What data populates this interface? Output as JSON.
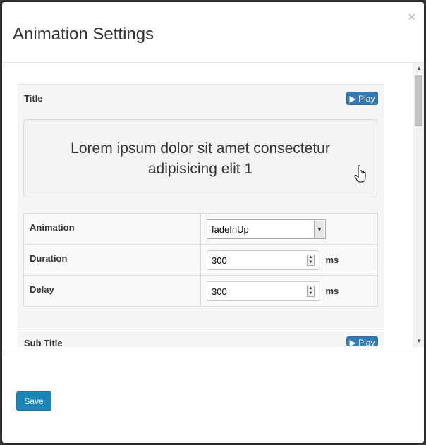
{
  "modal": {
    "title": "Animation Settings",
    "close_label": "×"
  },
  "panels": [
    {
      "label": "Title",
      "play_label": "▶ Play",
      "preview_text": "Lorem ipsum dolor sit amet consectetur adipisicing elit 1",
      "rows": [
        {
          "label": "Animation",
          "value": "fadeInUp",
          "type": "select"
        },
        {
          "label": "Duration",
          "value": "300",
          "unit": "ms",
          "type": "number"
        },
        {
          "label": "Delay",
          "value": "300",
          "unit": "ms",
          "type": "number"
        }
      ]
    },
    {
      "label": "Sub Title",
      "play_label": "▶ Play"
    }
  ],
  "footer": {
    "save_label": "Save"
  },
  "colors": {
    "primary_button": "#337ab7",
    "save_button": "#1a86b8",
    "panel_bg": "#f5f5f5"
  }
}
